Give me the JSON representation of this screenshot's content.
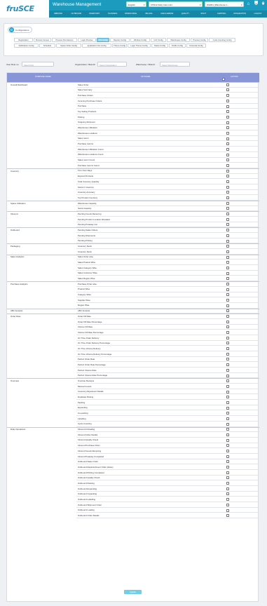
{
  "brand": {
    "logo_text": "fruSCE"
  },
  "header": {
    "app_title": "Warehouse Management",
    "language": "English",
    "client": "CI5112 Daily Care Ltd-I",
    "warehouse": "WH001 (Warehouse 1...",
    "icons": [
      "home-icon",
      "cart-icon",
      "help-icon",
      "settings-icon",
      "user-icon"
    ]
  },
  "nav": {
    "items": [
      "INBOUND",
      "OUTBOUND",
      "INVENTORY",
      "PLANNING",
      "WORKFORCE",
      "BILLING",
      "MAILS ERROR",
      "QUALITY",
      "ROOT",
      "SHIPPING",
      "INTEGRATION",
      "LOGOUT"
    ]
  },
  "config": {
    "badge_letter": "D",
    "label": "Configurations"
  },
  "tabs": {
    "row1": [
      "Registration",
      "Process Groups",
      "Process Permissions",
      "Login Preview",
      "KPI Config",
      "Reports Config",
      "Window Config",
      "Unit Config",
      "Warehouse Config",
      "Process Config",
      "Cycle Counting Config"
    ],
    "row2": [
      "Notification Config",
      "Schedule",
      "Space Order Config",
      "Application Info Config",
      "Theme Config",
      "Login Theme Config",
      "Status Config",
      "Profile Config",
      "Financial Config"
    ],
    "active": "KPI Config"
  },
  "filters": {
    "user_label": "User Role no",
    "user_placeholder": "Select Role",
    "org_label": "Organization / Branch",
    "org_placeholder": "Select Organization",
    "wh_label": "Warehouse / Branch",
    "wh_placeholder": "Select Warehouse"
  },
  "table": {
    "col_purpose": "PURPOSE NAME",
    "col_kpi": "KPI NAME",
    "col_action": "ACTION",
    "groups": [
      {
        "name": "Overall Dashboard",
        "items": [
          "Sales Order",
          "Sales Summary",
          "Purchase Orders",
          "Incoming Purchase Orders",
          "Purchase",
          "Top Selling Products",
          "Picking",
          "Outgoing Shipment",
          "Warehouse Utilisation",
          "Warehouse Locations",
          "Sales return",
          "Purchase returns",
          "Warehouse Utilisation Count",
          "Warehouse Locations Count",
          "Sales return Count",
          "Purchase returns Count"
        ]
      },
      {
        "name": "Inventory",
        "items": [
          "Turn Over Days",
          "Expired Products",
          "Total Inventory Quantity",
          "Stock in Inventory",
          "Inventory Accuracy",
          "Top Product Inventory"
        ]
      },
      {
        "name": "Space Utilization",
        "items": [
          "Warehouse Capacity",
          "Stock Capacity"
        ]
      },
      {
        "name": "Inbound",
        "items": [
          "Pending Goods Receiving",
          "Pending Product Location Allocation",
          "Pending Putaway List"
        ]
      },
      {
        "name": "Outbound",
        "items": [
          "Pending Sales Orders",
          "Pending Shipments",
          "Pending Picking"
        ]
      },
      {
        "name": "Packaging",
        "items": [
          "Inventory Stock",
          "Inventory Stock"
        ]
      },
      {
        "name": "Sales Analytics",
        "items": [
          "Sales Order wise",
          "Sales Product Wise",
          "Sales Category Wise",
          "Sales Customer Wise",
          "Sales Region Wise"
        ]
      },
      {
        "name": "Purchase Analytics",
        "items": [
          "Purchase Order wise",
          "Product Wise",
          "Category Wise",
          "Supplier Wise",
          "Region Wise"
        ]
      },
      {
        "name": "ABC Analysis",
        "items": [
          "ABC Analysis"
        ]
      },
      {
        "name": "Order Rate",
        "items": [
          "Order Fill Rate",
          "Order Fill Rate Percentage",
          "Volume Fill Rate",
          "Volume Fill Rate Percentage",
          "On Time Order Delivery",
          "On Time Order Delivery Percentage",
          "On Time Volume Delivery",
          "On Time Volume Delivery Percentage",
          "Perfect Order Rate",
          "Perfect Order Rate Percentage",
          "Perfect Volume Rate",
          "Perfect Volume Rate Percentage"
        ]
      },
      {
        "name": "Overview",
        "items": [
          "Overdue Receipts",
          "Manual Counts",
          "Inventory Adjustment Details",
          "Duplicate Picking",
          "Packing",
          "Expanding",
          "Co-packing",
          "Labelling",
          "Cycle Counting"
        ]
      },
      {
        "name": "Daily Operations",
        "items": [
          "Inbound Unloading",
          "Inbound Order Details",
          "Inbound Quality Check",
          "Inbound Purchase Order",
          "Inbound Goods Receiving",
          "Inbound Putaway Completed",
          "Outbound Sales Order",
          "Outbound Replenishment Order History",
          "Outbound Picking Completed",
          "Outbound Quality Check",
          "Outbound Packing",
          "Outbound Expanding",
          "Outbound Copacking",
          "Outbound Labelling",
          "Outbound Shipment Order",
          "Outbound Loading",
          "Outbound Order Details"
        ]
      }
    ]
  },
  "actions": {
    "update_label": "Update"
  },
  "colors": {
    "accent": "#1c9bbf",
    "table_header": "#8895d6",
    "button": "#6fcfe8"
  }
}
